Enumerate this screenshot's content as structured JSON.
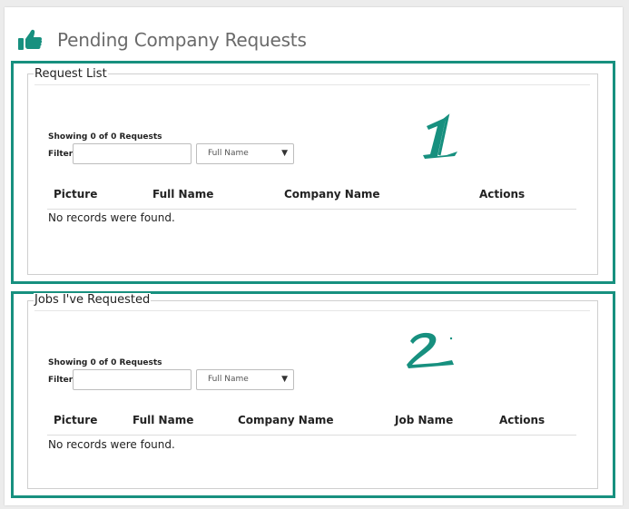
{
  "header": {
    "title": "Pending Company Requests",
    "icon": "thumbs-up-icon",
    "icon_color": "#17907f"
  },
  "accent_color": "#17907f",
  "request_list": {
    "legend": "Request List",
    "showing": "Showing 0 of 0 Requests",
    "filter_label": "Filter:",
    "filter_value": "",
    "select_value": "Full Name",
    "columns": [
      "Picture",
      "Full Name",
      "Company Name",
      "Actions"
    ],
    "empty_message": "No records were found.",
    "annotation": "1"
  },
  "jobs_requested": {
    "legend": "Jobs I've Requested",
    "showing": "Showing 0 of 0 Requests",
    "filter_label": "Filter:",
    "filter_value": "",
    "select_value": "Full Name",
    "columns": [
      "Picture",
      "Full Name",
      "Company Name",
      "Job Name",
      "Actions"
    ],
    "empty_message": "No records were found.",
    "annotation": "2"
  }
}
